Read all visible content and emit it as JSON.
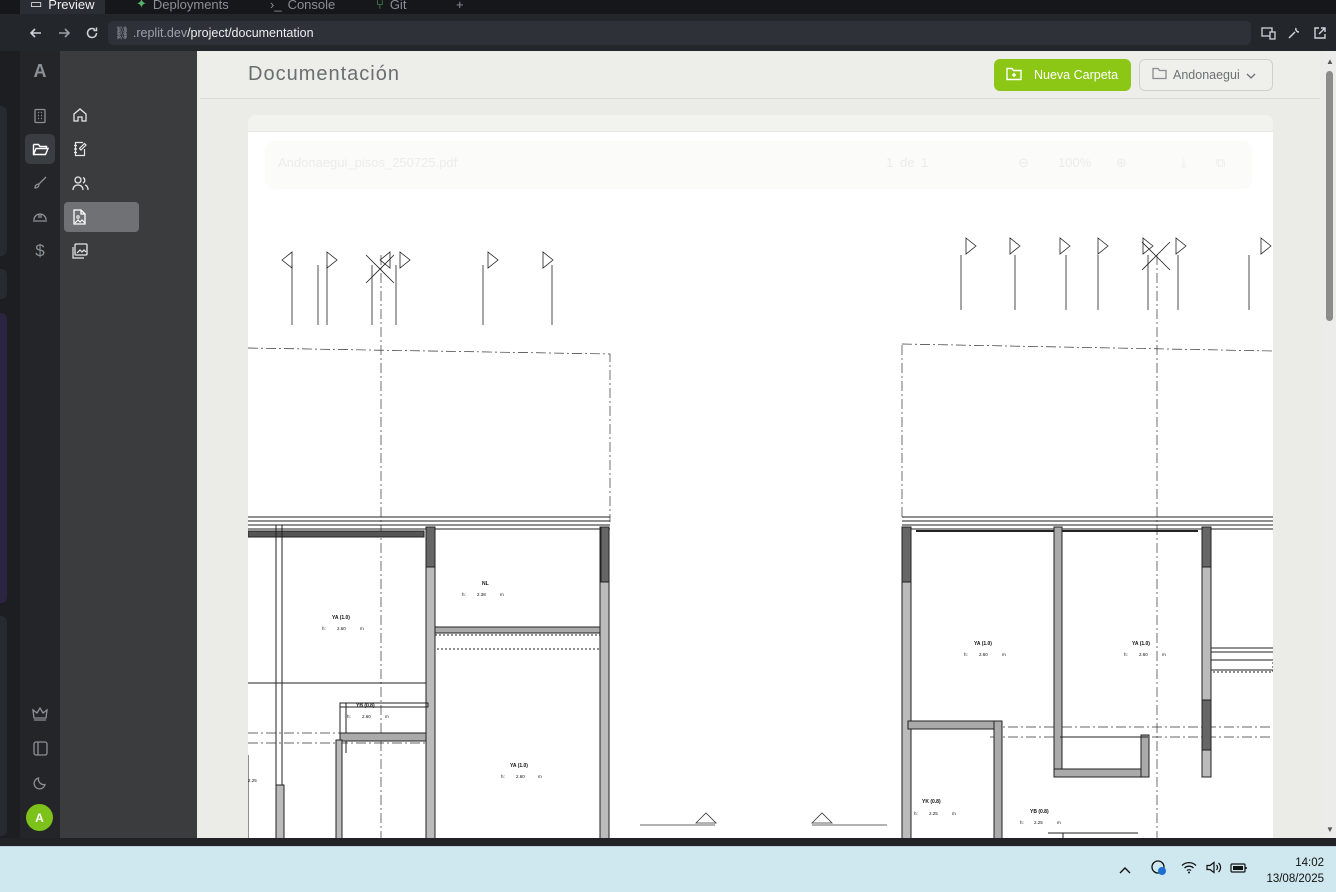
{
  "browser_tabs": [
    {
      "label": "Preview",
      "active": true,
      "icon": "monitor-icon"
    },
    {
      "label": "Deployments",
      "active": false,
      "icon": "rocket-icon"
    },
    {
      "label": "Console",
      "active": false,
      "icon": "terminal-icon"
    },
    {
      "label": "Git",
      "active": false,
      "icon": "git-branch-icon"
    }
  ],
  "address_bar": {
    "url_host": ".replit.dev",
    "url_path": "/project/documentation"
  },
  "app": {
    "logo_letter": "A",
    "user_initial": "A"
  },
  "rail_icons": [
    {
      "name": "building-icon",
      "active": false
    },
    {
      "name": "folder-open-icon",
      "active": true
    },
    {
      "name": "brush-icon",
      "active": false
    },
    {
      "name": "hard-hat-icon",
      "active": false
    },
    {
      "name": "dollar-icon",
      "active": false
    }
  ],
  "rail_bottom_icons": [
    "crown-icon",
    "sidebar-toggle-icon",
    "moon-icon"
  ],
  "subnav_icons": [
    {
      "name": "home-icon",
      "active": false
    },
    {
      "name": "notebook-pen-icon",
      "active": false
    },
    {
      "name": "users-icon",
      "active": false
    },
    {
      "name": "file-image-icon",
      "active": true
    },
    {
      "name": "images-icon",
      "active": false
    }
  ],
  "header": {
    "title": "Documentación",
    "new_folder_label": "Nueva Carpeta",
    "folder_select_value": "Andonaegui"
  },
  "pdf_toolbar": {
    "filename": "Andonaegui_pisos_250725.pdf",
    "page_current": "1",
    "page_sep": "de",
    "page_total": "1",
    "zoom": "100%"
  },
  "plan_labels": {
    "room_a": "YA (1.0)",
    "room_b": "NL",
    "room_c": "YB (0.8)",
    "room_d": "YA (1.0)",
    "room_e": "YB (0.8)",
    "room_f": "YK (0.8)",
    "h_prefix": "h:",
    "h_260": "2.60",
    "h_238": "2.38",
    "h_225": "2.25",
    "unit": "m"
  },
  "taskbar": {
    "time": "14:02",
    "date": "13/08/2025"
  },
  "colors": {
    "accent": "#8bc714",
    "rail_bg": "#232528",
    "subnav_bg": "#3b3c3e",
    "main_bg": "#ebebe7",
    "taskbar_bg": "#cfe7ee"
  }
}
